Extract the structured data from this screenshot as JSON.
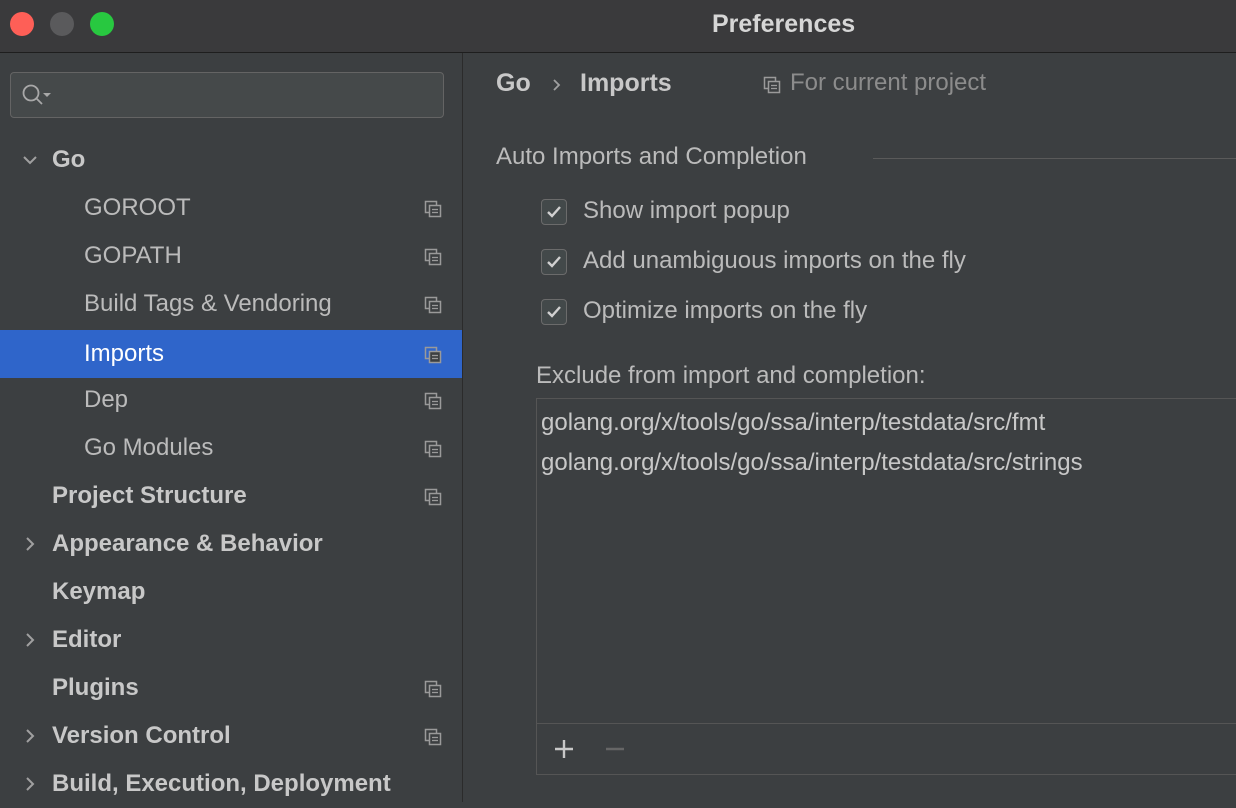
{
  "window": {
    "title": "Preferences"
  },
  "search": {
    "value": "",
    "placeholder": ""
  },
  "sidebar": {
    "items": [
      {
        "label": "Go",
        "expanded": true
      },
      {
        "label": "GOROOT"
      },
      {
        "label": "GOPATH"
      },
      {
        "label": "Build Tags & Vendoring"
      },
      {
        "label": "Imports",
        "selected": true
      },
      {
        "label": "Dep"
      },
      {
        "label": "Go Modules"
      },
      {
        "label": "Project Structure"
      },
      {
        "label": "Appearance & Behavior",
        "expanded": false
      },
      {
        "label": "Keymap"
      },
      {
        "label": "Editor",
        "expanded": false
      },
      {
        "label": "Plugins"
      },
      {
        "label": "Version Control",
        "expanded": false
      },
      {
        "label": "Build, Execution, Deployment",
        "expanded": false
      }
    ]
  },
  "breadcrumb": {
    "parent": "Go",
    "current": "Imports",
    "scope": "For current project"
  },
  "section": {
    "title": "Auto Imports and Completion"
  },
  "options": [
    {
      "label": "Show import popup",
      "checked": true
    },
    {
      "label": "Add unambiguous imports on the fly",
      "checked": true
    },
    {
      "label": "Optimize imports on the fly",
      "checked": true
    }
  ],
  "exclude": {
    "label": "Exclude from import and completion:",
    "items": [
      "golang.org/x/tools/go/ssa/interp/testdata/src/fmt",
      "golang.org/x/tools/go/ssa/interp/testdata/src/strings"
    ]
  },
  "colors": {
    "selection": "#2f65ca",
    "background": "#3c3f41",
    "accent_text": "#ffffff"
  },
  "icons": {
    "close": "close-window-icon",
    "minimize": "minimize-window-icon",
    "maximize": "maximize-window-icon",
    "search": "search-icon",
    "project": "project-scope-icon",
    "chevron_down": "chevron-down-icon",
    "chevron_right": "chevron-right-icon",
    "add": "add-icon",
    "remove": "remove-icon"
  }
}
